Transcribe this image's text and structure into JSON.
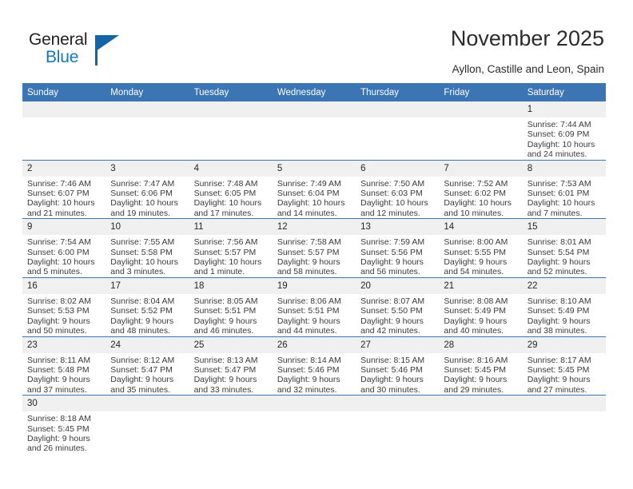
{
  "brand": {
    "name_part1": "General",
    "name_part2": "Blue",
    "triangle_color": "#1465a8",
    "blue_text_color": "#1278be"
  },
  "header": {
    "title": "November 2025",
    "location": "Ayllon, Castille and Leon, Spain"
  },
  "theme": {
    "header_blue": "#3c75b4",
    "daynum_band": "#f0f0f0",
    "text": "#3a3a3a"
  },
  "weekday_headers": [
    "Sunday",
    "Monday",
    "Tuesday",
    "Wednesday",
    "Thursday",
    "Friday",
    "Saturday"
  ],
  "labels": {
    "sunrise_prefix": "Sunrise:",
    "sunset_prefix": "Sunset:",
    "daylight_prefix": "Daylight:"
  },
  "weeks": [
    [
      {
        "day": "",
        "blank": true
      },
      {
        "day": "",
        "blank": true
      },
      {
        "day": "",
        "blank": true
      },
      {
        "day": "",
        "blank": true
      },
      {
        "day": "",
        "blank": true
      },
      {
        "day": "",
        "blank": true
      },
      {
        "day": "1",
        "sunrise": "Sunrise: 7:44 AM",
        "sunset": "Sunset: 6:09 PM",
        "daylight_line1": "Daylight: 10 hours",
        "daylight_line2": "and 24 minutes."
      }
    ],
    [
      {
        "day": "2",
        "sunrise": "Sunrise: 7:46 AM",
        "sunset": "Sunset: 6:07 PM",
        "daylight_line1": "Daylight: 10 hours",
        "daylight_line2": "and 21 minutes."
      },
      {
        "day": "3",
        "sunrise": "Sunrise: 7:47 AM",
        "sunset": "Sunset: 6:06 PM",
        "daylight_line1": "Daylight: 10 hours",
        "daylight_line2": "and 19 minutes."
      },
      {
        "day": "4",
        "sunrise": "Sunrise: 7:48 AM",
        "sunset": "Sunset: 6:05 PM",
        "daylight_line1": "Daylight: 10 hours",
        "daylight_line2": "and 17 minutes."
      },
      {
        "day": "5",
        "sunrise": "Sunrise: 7:49 AM",
        "sunset": "Sunset: 6:04 PM",
        "daylight_line1": "Daylight: 10 hours",
        "daylight_line2": "and 14 minutes."
      },
      {
        "day": "6",
        "sunrise": "Sunrise: 7:50 AM",
        "sunset": "Sunset: 6:03 PM",
        "daylight_line1": "Daylight: 10 hours",
        "daylight_line2": "and 12 minutes."
      },
      {
        "day": "7",
        "sunrise": "Sunrise: 7:52 AM",
        "sunset": "Sunset: 6:02 PM",
        "daylight_line1": "Daylight: 10 hours",
        "daylight_line2": "and 10 minutes."
      },
      {
        "day": "8",
        "sunrise": "Sunrise: 7:53 AM",
        "sunset": "Sunset: 6:01 PM",
        "daylight_line1": "Daylight: 10 hours",
        "daylight_line2": "and 7 minutes."
      }
    ],
    [
      {
        "day": "9",
        "sunrise": "Sunrise: 7:54 AM",
        "sunset": "Sunset: 6:00 PM",
        "daylight_line1": "Daylight: 10 hours",
        "daylight_line2": "and 5 minutes."
      },
      {
        "day": "10",
        "sunrise": "Sunrise: 7:55 AM",
        "sunset": "Sunset: 5:58 PM",
        "daylight_line1": "Daylight: 10 hours",
        "daylight_line2": "and 3 minutes."
      },
      {
        "day": "11",
        "sunrise": "Sunrise: 7:56 AM",
        "sunset": "Sunset: 5:57 PM",
        "daylight_line1": "Daylight: 10 hours",
        "daylight_line2": "and 1 minute."
      },
      {
        "day": "12",
        "sunrise": "Sunrise: 7:58 AM",
        "sunset": "Sunset: 5:57 PM",
        "daylight_line1": "Daylight: 9 hours",
        "daylight_line2": "and 58 minutes."
      },
      {
        "day": "13",
        "sunrise": "Sunrise: 7:59 AM",
        "sunset": "Sunset: 5:56 PM",
        "daylight_line1": "Daylight: 9 hours",
        "daylight_line2": "and 56 minutes."
      },
      {
        "day": "14",
        "sunrise": "Sunrise: 8:00 AM",
        "sunset": "Sunset: 5:55 PM",
        "daylight_line1": "Daylight: 9 hours",
        "daylight_line2": "and 54 minutes."
      },
      {
        "day": "15",
        "sunrise": "Sunrise: 8:01 AM",
        "sunset": "Sunset: 5:54 PM",
        "daylight_line1": "Daylight: 9 hours",
        "daylight_line2": "and 52 minutes."
      }
    ],
    [
      {
        "day": "16",
        "sunrise": "Sunrise: 8:02 AM",
        "sunset": "Sunset: 5:53 PM",
        "daylight_line1": "Daylight: 9 hours",
        "daylight_line2": "and 50 minutes."
      },
      {
        "day": "17",
        "sunrise": "Sunrise: 8:04 AM",
        "sunset": "Sunset: 5:52 PM",
        "daylight_line1": "Daylight: 9 hours",
        "daylight_line2": "and 48 minutes."
      },
      {
        "day": "18",
        "sunrise": "Sunrise: 8:05 AM",
        "sunset": "Sunset: 5:51 PM",
        "daylight_line1": "Daylight: 9 hours",
        "daylight_line2": "and 46 minutes."
      },
      {
        "day": "19",
        "sunrise": "Sunrise: 8:06 AM",
        "sunset": "Sunset: 5:51 PM",
        "daylight_line1": "Daylight: 9 hours",
        "daylight_line2": "and 44 minutes."
      },
      {
        "day": "20",
        "sunrise": "Sunrise: 8:07 AM",
        "sunset": "Sunset: 5:50 PM",
        "daylight_line1": "Daylight: 9 hours",
        "daylight_line2": "and 42 minutes."
      },
      {
        "day": "21",
        "sunrise": "Sunrise: 8:08 AM",
        "sunset": "Sunset: 5:49 PM",
        "daylight_line1": "Daylight: 9 hours",
        "daylight_line2": "and 40 minutes."
      },
      {
        "day": "22",
        "sunrise": "Sunrise: 8:10 AM",
        "sunset": "Sunset: 5:49 PM",
        "daylight_line1": "Daylight: 9 hours",
        "daylight_line2": "and 38 minutes."
      }
    ],
    [
      {
        "day": "23",
        "sunrise": "Sunrise: 8:11 AM",
        "sunset": "Sunset: 5:48 PM",
        "daylight_line1": "Daylight: 9 hours",
        "daylight_line2": "and 37 minutes."
      },
      {
        "day": "24",
        "sunrise": "Sunrise: 8:12 AM",
        "sunset": "Sunset: 5:47 PM",
        "daylight_line1": "Daylight: 9 hours",
        "daylight_line2": "and 35 minutes."
      },
      {
        "day": "25",
        "sunrise": "Sunrise: 8:13 AM",
        "sunset": "Sunset: 5:47 PM",
        "daylight_line1": "Daylight: 9 hours",
        "daylight_line2": "and 33 minutes."
      },
      {
        "day": "26",
        "sunrise": "Sunrise: 8:14 AM",
        "sunset": "Sunset: 5:46 PM",
        "daylight_line1": "Daylight: 9 hours",
        "daylight_line2": "and 32 minutes."
      },
      {
        "day": "27",
        "sunrise": "Sunrise: 8:15 AM",
        "sunset": "Sunset: 5:46 PM",
        "daylight_line1": "Daylight: 9 hours",
        "daylight_line2": "and 30 minutes."
      },
      {
        "day": "28",
        "sunrise": "Sunrise: 8:16 AM",
        "sunset": "Sunset: 5:45 PM",
        "daylight_line1": "Daylight: 9 hours",
        "daylight_line2": "and 29 minutes."
      },
      {
        "day": "29",
        "sunrise": "Sunrise: 8:17 AM",
        "sunset": "Sunset: 5:45 PM",
        "daylight_line1": "Daylight: 9 hours",
        "daylight_line2": "and 27 minutes."
      }
    ],
    [
      {
        "day": "30",
        "sunrise": "Sunrise: 8:18 AM",
        "sunset": "Sunset: 5:45 PM",
        "daylight_line1": "Daylight: 9 hours",
        "daylight_line2": "and 26 minutes."
      },
      {
        "day": "",
        "blank": true
      },
      {
        "day": "",
        "blank": true
      },
      {
        "day": "",
        "blank": true
      },
      {
        "day": "",
        "blank": true
      },
      {
        "day": "",
        "blank": true
      },
      {
        "day": "",
        "blank": true
      }
    ]
  ]
}
